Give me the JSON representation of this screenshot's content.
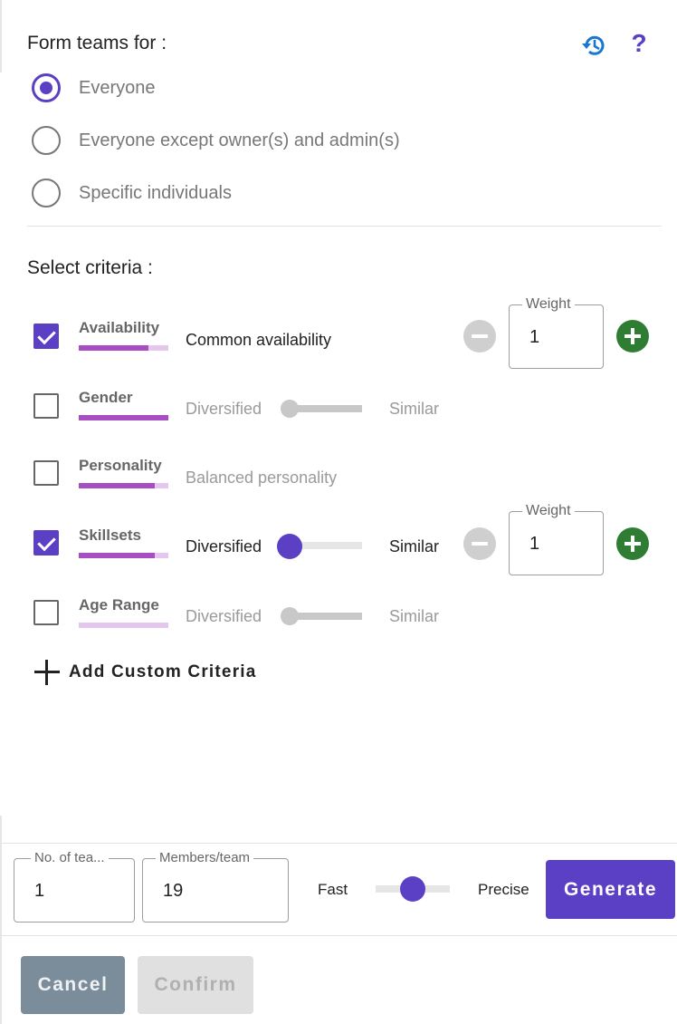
{
  "header": {
    "title": "Form teams for :",
    "history_icon": "history-icon",
    "help_icon": "help-icon",
    "help_glyph": "?"
  },
  "audience": {
    "options": [
      {
        "label": "Everyone",
        "selected": true
      },
      {
        "label": "Everyone except owner(s) and admin(s)",
        "selected": false
      },
      {
        "label": "Specific individuals",
        "selected": false
      }
    ]
  },
  "criteria": {
    "title": "Select criteria :",
    "weight_label": "Weight",
    "items": [
      {
        "name": "Availability",
        "checked": true,
        "bar_fill": 0.78,
        "mode": "text",
        "text": "Common availability",
        "weight": "1"
      },
      {
        "name": "Gender",
        "checked": false,
        "bar_fill": 1.0,
        "mode": "slider",
        "left_label": "Diversified",
        "right_label": "Similar",
        "slider_value": 0.0
      },
      {
        "name": "Personality",
        "checked": false,
        "bar_fill": 0.85,
        "mode": "text",
        "text": "Balanced personality"
      },
      {
        "name": "Skillsets",
        "checked": true,
        "bar_fill": 0.85,
        "mode": "slider",
        "left_label": "Diversified",
        "right_label": "Similar",
        "slider_value": 0.0,
        "weight": "1"
      },
      {
        "name": "Age Range",
        "checked": false,
        "bar_fill": 0.0,
        "mode": "slider",
        "left_label": "Diversified",
        "right_label": "Similar",
        "slider_value": 0.0
      }
    ],
    "add_custom": "Add Custom Criteria"
  },
  "footer": {
    "teams_label": "No. of tea...",
    "teams_value": "1",
    "members_label": "Members/team",
    "members_value": "19",
    "speed_left": "Fast",
    "speed_right": "Precise",
    "speed_value": 0.5,
    "generate_label": "Generate",
    "cancel_label": "Cancel",
    "confirm_label": "Confirm"
  },
  "colors": {
    "accent": "#5b3fc4",
    "add_green": "#2e7d32",
    "criteria_bar": "#a64ec2",
    "criteria_bar_bg": "#e3c7ef",
    "cancel": "#7b8d9b",
    "confirm_disabled": "#e0e0e0"
  }
}
